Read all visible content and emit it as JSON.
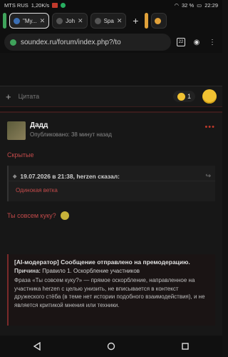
{
  "status_bar": {
    "carrier": "MTS RUS",
    "speed": "1,20K/s",
    "battery": "32 %",
    "time": "22:29"
  },
  "tabs": [
    {
      "label": "\"My..."
    },
    {
      "label": "Joh"
    },
    {
      "label": "Spa"
    }
  ],
  "url_bar": {
    "url": "soundex.ru/forum/index.php?/to",
    "tab_count": "22"
  },
  "editor": {
    "placeholder": "Цитата",
    "reaction_count": "1"
  },
  "post": {
    "author": "Дадд",
    "posted": "Опубликовано: 38 минут назад",
    "hidden_label": "Скрытые",
    "quote_header": "19.07.2026 в 21:38, herzen сказал:",
    "quote_body": "Одинокая ветка",
    "reply": "Ты совсем куку?"
  },
  "moderation": {
    "title": "[AI-модератор] Сообщение отправлено на премодерацию.",
    "reason_label": "Причина:",
    "reason": "Правило 1. Оскорбление участников",
    "text": "Фраза «Ты совсем куку?» — прямое оскорбление, направленное на участника herzen с целью унизить, не вписывается в контекст дружеского стёба (в теме нет истории подобного взаимодействия), и не является критикой мнения или техники."
  },
  "colors": {
    "accent": "#c24a4a",
    "background": "#121212",
    "emoji": "#f1c232"
  }
}
